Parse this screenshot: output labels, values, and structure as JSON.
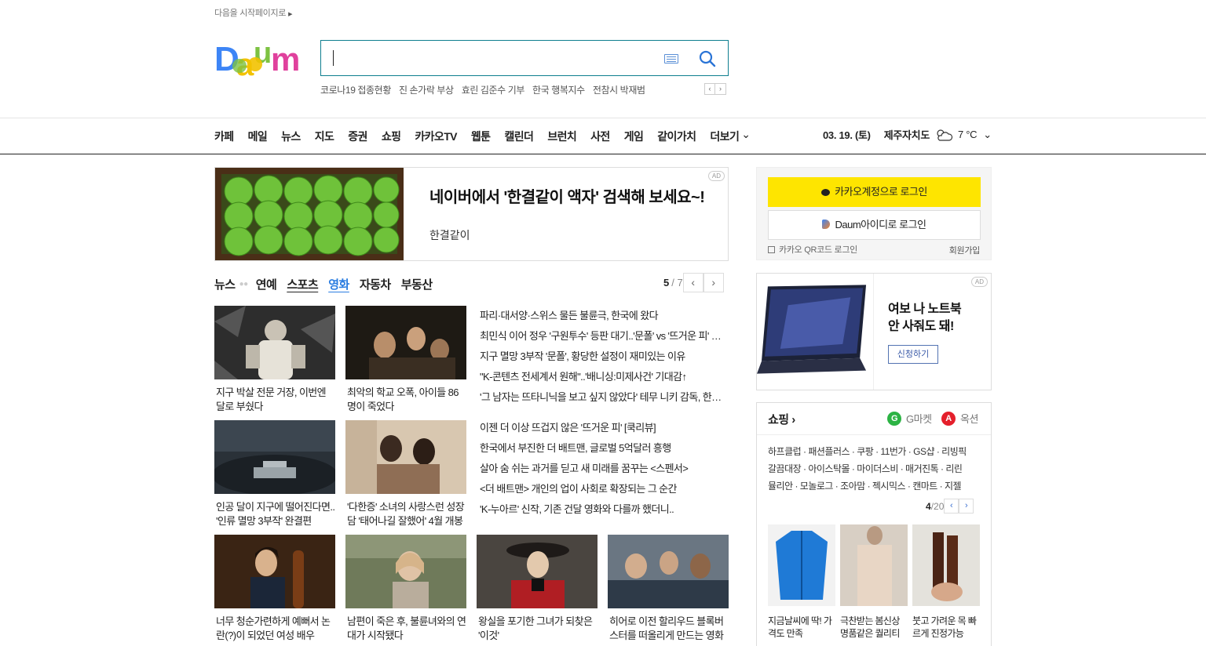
{
  "top": {
    "start_page": "다음을 시작페이지로"
  },
  "brand": {
    "logo": "Daum",
    "logo_colors": [
      "#3d85f6",
      "#f2c200",
      "#7dc242",
      "#e0419d",
      "#f2842b"
    ]
  },
  "search": {
    "value": "",
    "placeholder": ""
  },
  "trending": [
    "코로나19 접종현황",
    "진 손가락 부상",
    "효린 김준수 기부",
    "한국 행복지수",
    "전참시 박재범"
  ],
  "gnb": [
    "카페",
    "메일",
    "뉴스",
    "지도",
    "증권",
    "쇼핑",
    "카카오TV",
    "웹툰",
    "캘린더",
    "브런치",
    "사전",
    "게임",
    "같이가치"
  ],
  "gnb_more": "더보기",
  "weather": {
    "date": "03. 19. (토)",
    "region": "제주자치도",
    "temp": "7 °C"
  },
  "ad_banner": {
    "title": "네이버에서 '한결같이 액자' 검색해 보세요~!",
    "subtitle": "한결같이",
    "badge": "AD"
  },
  "news_tabs": {
    "items": [
      "뉴스",
      "연예",
      "스포츠",
      "영화",
      "자동차",
      "부동산"
    ],
    "active": "영화"
  },
  "pager": {
    "current": "5",
    "total": "/ 7"
  },
  "thumbs_top": [
    {
      "caption": "지구 박살 전문 거장, 이번엔 달로 부쉈다"
    },
    {
      "caption": "최악의 학교 오폭, 아이들 86명이 죽었다"
    },
    {
      "caption": "인공 달이 지구에 떨어진다면.. '인류 멸망 3부작' 완결편"
    },
    {
      "caption": "'다한증' 소녀의 사랑스런 성장담 '태어나길 잘했어' 4월 개봉"
    }
  ],
  "headlines_1": [
    "파리·대서양·스위스 물든 불륜극, 한국에 왔다",
    "최민식 이어 정우 '구원투수' 등판 대기..'문폴' vs '뜨거운 피' 맞대결",
    "지구 멸망 3부작 '문폴', 황당한 설정이 재미있는 이유",
    "\"K-콘텐츠 전세계서 원해\"..'배니싱:미제사건' 기대감↑",
    "'그 남자는 뜨타니닉을 보고 싶지 않았다' 테무 니키 감독, 한국 개봉"
  ],
  "headlines_2": [
    "이젠 더 이상 뜨겁지 않은 '뜨거운 피' [쿡리뷰]",
    "한국에서 부진한 더 배트맨, 글로벌 5억달러 흥행",
    "살아 숨 쉬는 과거를 딛고 새 미래를 꿈꾸는 <스펜서>",
    "<더 배트맨> 개인의 업이 사회로 확장되는 그 순간",
    "'K-누아르' 신작, 기존 건달 영화와 다를까 했더니.."
  ],
  "thumbs_bottom": [
    {
      "caption": "너무 청순가련하게 예뻐서 논란(?)이 되었던 여성 배우"
    },
    {
      "caption": "남편이 죽은 후, 불륜녀와의 연대가 시작됐다"
    },
    {
      "caption": "왕실을 포기한 그녀가 되찾은 '이것'"
    },
    {
      "caption": "히어로 이전 할리우드 블록버스터를 떠올리게 만드는 영화"
    }
  ],
  "login": {
    "kakao": "카카오계정으로 로그인",
    "daum": "Daum아이디로 로그인",
    "qr": "카카오 QR코드 로그인",
    "signup": "회원가입"
  },
  "side_ad": {
    "title_1": "여보 나 노트북",
    "title_2": "안 사줘도 돼!",
    "button": "신청하기",
    "badge": "AD"
  },
  "shopping": {
    "title": "쇼핑",
    "gmarket": "G마켓",
    "auction": "옥션",
    "links": [
      "하프클럽 · 패션플러스 · 쿠팡 · 11번가 · GS샵 · 리빙픽",
      "갈끔대장 · 아이스탁몰 · 마이더스비 · 매거진톡 · 리린",
      "뮬리안 · 모놀로그 · 조아맘 · 젝시믹스 · 캔마트 · 지젤"
    ],
    "page_current": "4",
    "page_total": "/20",
    "items": [
      {
        "caption": "지금날씨에 딱! 가격도 만족"
      },
      {
        "caption": "극찬받는 봄신상 명품같은 퀄리티"
      },
      {
        "caption": "붓고 가려운 목 빠르게 진정가능"
      }
    ]
  }
}
